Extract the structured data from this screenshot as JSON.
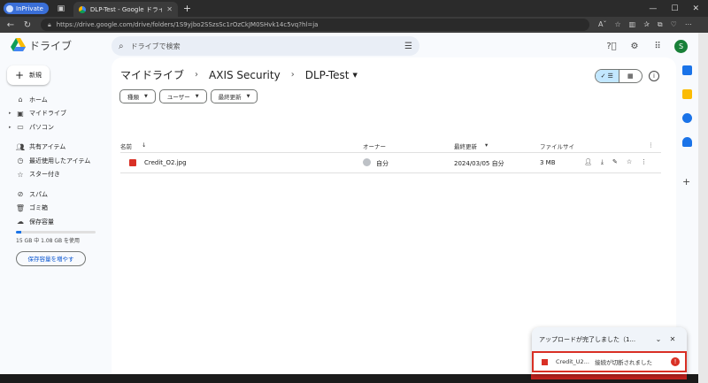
{
  "browser": {
    "mode_label": "InPrivate",
    "tab_title": "DLP-Test - Google ドライブ",
    "url": "https://drive.google.com/drive/folders/1S9yjbo2SSzsSc1rOzCkJM0SHvk14c5vq?hl=ja"
  },
  "app": {
    "name": "ドライブ",
    "search_placeholder": "ドライブで検索",
    "avatar_letter": "S"
  },
  "sidebar": {
    "new_label": "新規",
    "items": [
      {
        "label": "ホーム",
        "icon": "home-icon"
      },
      {
        "label": "マイドライブ",
        "icon": "my-drive-icon"
      },
      {
        "label": "パソコン",
        "icon": "computer-icon"
      },
      {
        "label": "共有アイテム",
        "icon": "shared-icon"
      },
      {
        "label": "最近使用したアイテム",
        "icon": "clock-icon"
      },
      {
        "label": "スター付き",
        "icon": "star-icon"
      },
      {
        "label": "スパム",
        "icon": "spam-icon"
      },
      {
        "label": "ゴミ箱",
        "icon": "trash-icon"
      },
      {
        "label": "保存容量",
        "icon": "cloud-icon"
      }
    ],
    "storage_text": "15 GB 中 1.08 GB を使用",
    "storage_fraction": 0.072,
    "get_storage_label": "保存容量を増やす"
  },
  "main": {
    "breadcrumbs": [
      "マイドライブ",
      "AXIS Security",
      "DLP-Test"
    ],
    "filters": [
      "種類",
      "ユーザー",
      "最終更新"
    ],
    "columns": {
      "name": "名前",
      "owner": "オーナー",
      "modified": "最終更新",
      "size": "ファイルサイ"
    },
    "files": [
      {
        "name": "Credit_O2.jpg",
        "owner": "自分",
        "modified": "2024/03/05 自分",
        "size": "3 MB"
      }
    ]
  },
  "upload_panel": {
    "title": "アップロードが完了しました（1...",
    "item_name": "Credit_U2...",
    "item_status": "接続が切断されました",
    "error_color": "#d93025"
  }
}
